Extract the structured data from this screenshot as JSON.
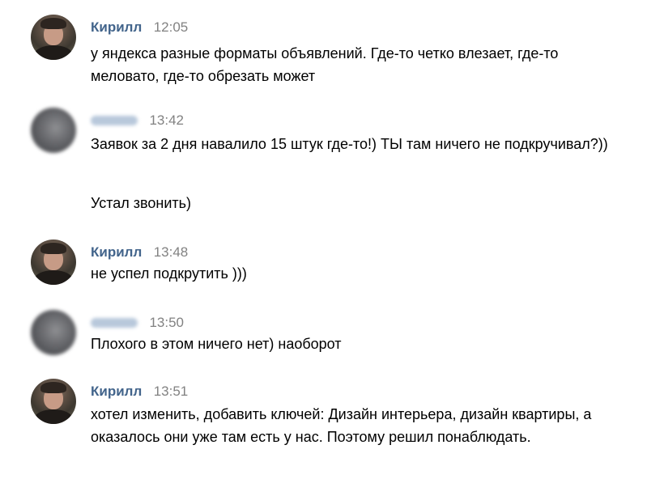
{
  "messages": [
    {
      "author": "Кирилл",
      "time": "12:05",
      "avatar_icon": "user-photo-icon",
      "text": "у яндекса разные форматы объявлений. Где-то четко влезает, где-то меловато, где-то обрезать может"
    },
    {
      "author": "",
      "time": "13:42",
      "avatar_icon": "blurred-user-photo-icon",
      "text": "Заявок за 2 дня навалило 15 штук где-то!) ТЫ там ничего не подкручивал?))",
      "text2": "Устал звонить)"
    },
    {
      "author": "Кирилл",
      "time": "13:48",
      "avatar_icon": "user-photo-icon",
      "text": "не успел подкрутить )))"
    },
    {
      "author": "",
      "time": "13:50",
      "avatar_icon": "blurred-user-photo-icon",
      "text": "Плохого в этом ничего нет) наоборот"
    },
    {
      "author": "Кирилл",
      "time": "13:51",
      "avatar_icon": "user-photo-icon",
      "text": "хотел изменить, добавить ключей: Дизайн интерьера, дизайн квартиры, а оказалось они уже там есть у нас. Поэтому решил понаблюдать."
    }
  ],
  "colors": {
    "author_name": "#42648b",
    "timestamp": "#828282",
    "message_text": "#000000",
    "background": "#ffffff"
  }
}
